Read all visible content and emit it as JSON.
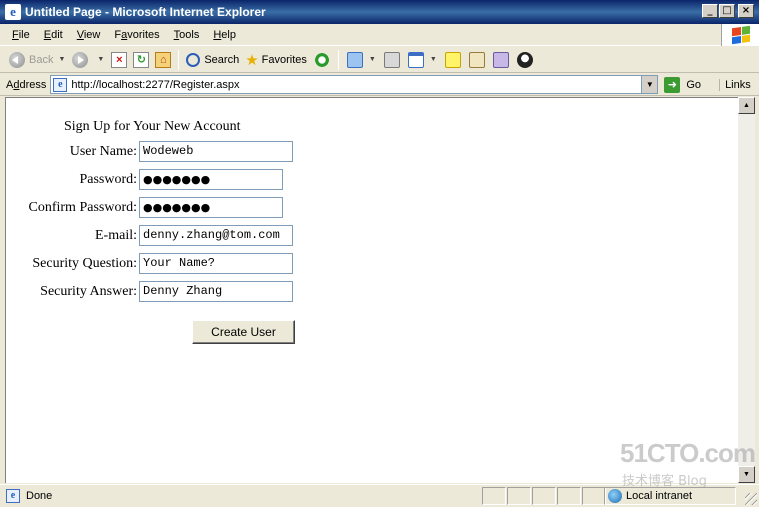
{
  "window": {
    "title": "Untitled Page - Microsoft Internet Explorer",
    "buttons": {
      "minimize": "_",
      "maximize": "□",
      "close": "×"
    }
  },
  "menu": {
    "items": [
      {
        "key": "F",
        "rest": "ile"
      },
      {
        "key": "E",
        "rest": "dit"
      },
      {
        "key": "V",
        "rest": "iew"
      },
      {
        "key": "",
        "pre": "F",
        "ul": "a",
        "rest": "vorites"
      },
      {
        "key": "T",
        "rest": "ools"
      },
      {
        "key": "H",
        "rest": "elp"
      }
    ]
  },
  "toolbar": {
    "back_label": "Back",
    "search_label": "Search",
    "favorites_label": "Favorites"
  },
  "address": {
    "label_key": "d",
    "label_pre": "A",
    "label_rest": "ress",
    "url": "http://localhost:2277/Register.aspx",
    "go_label": "Go",
    "links_label": "Links"
  },
  "form": {
    "title": "Sign Up for Your New Account",
    "fields": [
      {
        "label": "User Name:",
        "value": "Wodeweb"
      },
      {
        "label": "Password:",
        "value": "●●●●●●●"
      },
      {
        "label": "Confirm Password:",
        "value": "●●●●●●●"
      },
      {
        "label": "E-mail:",
        "value": "denny.zhang@tom.com"
      },
      {
        "label": "Security Question:",
        "value": "Your Name?"
      },
      {
        "label": "Security Answer:",
        "value": "Denny Zhang"
      }
    ],
    "submit_label": "Create User"
  },
  "status": {
    "text": "Done",
    "zone": "Local intranet"
  },
  "watermark": {
    "main": "51CTO.com",
    "sub": "技术博客  Blog"
  }
}
